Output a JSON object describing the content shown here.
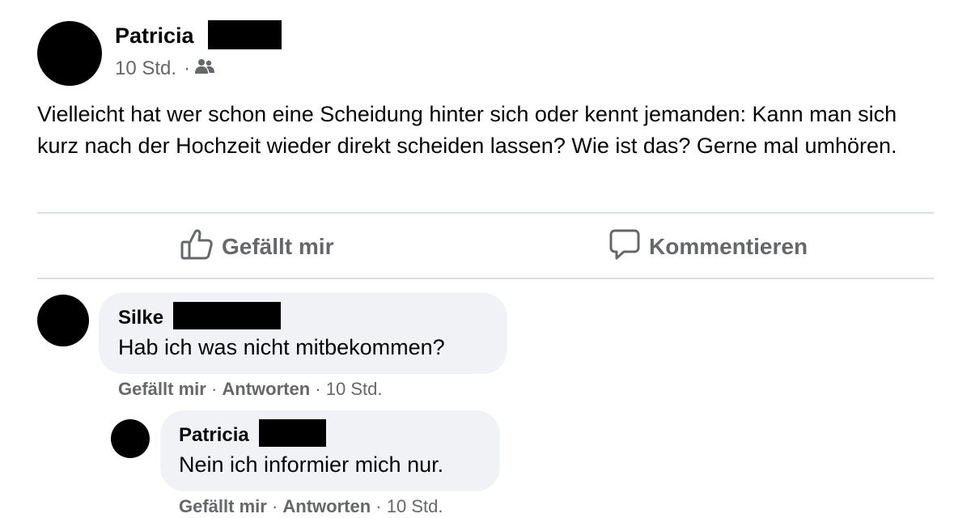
{
  "post": {
    "author": "Patricia",
    "time": "10 Std.",
    "audience_icon": "friends-icon",
    "text": "Vielleicht hat wer schon eine Scheidung hinter sich oder kennt jemanden: Kann man sich kurz nach der Hochzeit wieder direkt scheiden lassen? Wie ist das? Gerne mal umhören."
  },
  "actions": {
    "like_label": "Gefällt mir",
    "comment_label": "Kommentieren"
  },
  "comments": [
    {
      "author": "Silke",
      "text": "Hab ich was nicht mitbekommen?",
      "like_label": "Gefällt mir",
      "reply_label": "Antworten",
      "time": "10 Std."
    },
    {
      "author": "Patricia",
      "text": "Nein ich informier mich nur.",
      "like_label": "Gefällt mir",
      "reply_label": "Antworten",
      "time": "10 Std."
    }
  ],
  "colors": {
    "text": "#050505",
    "secondary": "#65676b",
    "bubble": "#f0f2f5",
    "divider": "#dadde1",
    "redaction": "#000000"
  }
}
